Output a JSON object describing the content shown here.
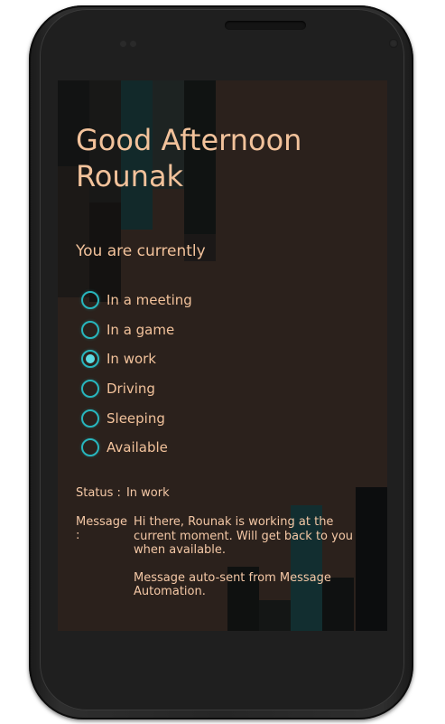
{
  "greeting": {
    "line1": "Good Afternoon",
    "line2": "Rounak"
  },
  "subtitle": "You are currently",
  "options": [
    {
      "label": "In a meeting",
      "checked": false
    },
    {
      "label": "In a game",
      "checked": false
    },
    {
      "label": "In work",
      "checked": true
    },
    {
      "label": "Driving",
      "checked": false
    },
    {
      "label": "Sleeping",
      "checked": false
    },
    {
      "label": "Available",
      "checked": false
    }
  ],
  "status": {
    "label": "Status :",
    "value": "In work"
  },
  "message": {
    "label": "Message :",
    "text": "Hi there, Rounak is working at the current moment. Will get back to you when available.",
    "footer": "Message auto-sent from Message Automation."
  },
  "colors": {
    "accent": "#28b6bd",
    "text": "#f2c29b",
    "background": "#2b211c"
  }
}
